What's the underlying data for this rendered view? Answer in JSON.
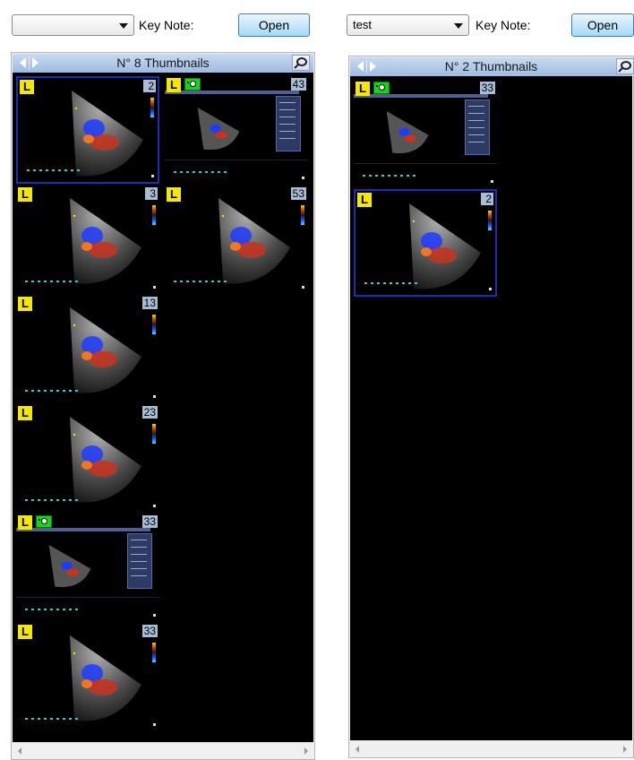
{
  "left_panel": {
    "combo_value": "",
    "keynote_label": "Key Note:",
    "open_label": "Open",
    "title": "N° 8 Thumbnails",
    "thumbnails": [
      {
        "count": "2",
        "selected": true,
        "cam": false,
        "wide": false
      },
      {
        "count": "43",
        "selected": false,
        "cam": true,
        "wide": true
      },
      {
        "count": "3",
        "selected": false,
        "cam": false,
        "wide": false
      },
      {
        "count": "53",
        "selected": false,
        "cam": false,
        "wide": false
      },
      {
        "count": "13",
        "selected": false,
        "cam": false,
        "wide": false
      },
      {
        "count": "23",
        "selected": false,
        "cam": false,
        "wide": false
      },
      {
        "count": "33",
        "selected": false,
        "cam": true,
        "wide": true
      },
      {
        "count": "33",
        "selected": false,
        "cam": false,
        "wide": false
      }
    ]
  },
  "right_panel": {
    "combo_value": "test",
    "keynote_label": "Key Note:",
    "open_label": "Open",
    "title": "N° 2 Thumbnails",
    "thumbnails": [
      {
        "count": "33",
        "selected": false,
        "cam": true,
        "wide": true
      },
      {
        "count": "2",
        "selected": true,
        "cam": false,
        "wide": false
      }
    ]
  },
  "badges": {
    "l_label": "L"
  },
  "icons": {
    "nav_prev": "triangle-left-icon",
    "nav_next": "triangle-right-icon",
    "pin": "pin-icon",
    "dropdown": "chevron-down-icon",
    "camera": "camera-icon"
  },
  "colors": {
    "title_bar": "#9fbbe0",
    "selected_border": "#1a2fb0",
    "badge_l": "#f5e800",
    "badge_cam": "#17d417",
    "count_badge": "#a9bcd6",
    "viewport": "#000000",
    "open_button": "#a7d9f5"
  }
}
